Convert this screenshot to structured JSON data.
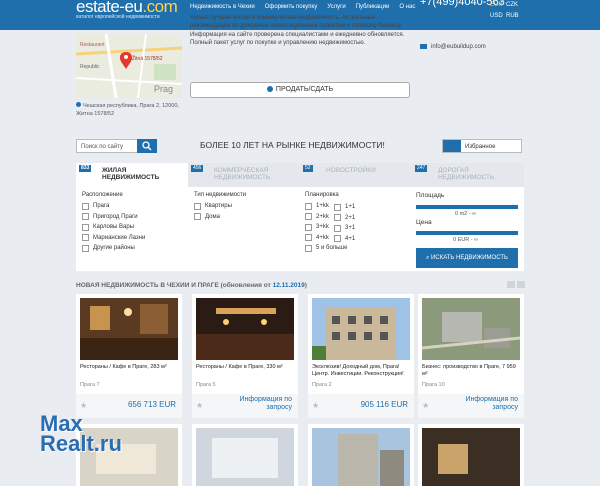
{
  "header": {
    "logo": "estate-eu",
    "logo_domain": ".com",
    "logo_sub": "каталог европейской недвижимости",
    "nav": [
      "Недвижимость в Чехии",
      "Оформить покупку",
      "Услуги",
      "Публикации",
      "О нас"
    ],
    "phone": "+7(499)4040-563",
    "currencies": [
      "EUR",
      "CZK",
      "USD",
      "RUB"
    ]
  },
  "map": {
    "pin_label": "Žitná 1578/52",
    "labels": [
      "Restaurant",
      "Republic",
      "Prag"
    ]
  },
  "address": "Чешская республика, Прага 2, 12000, Житна 1578/52",
  "intro": "только лучшая жилая и коммерческая недвижимость. Актуальные рекомендации по доходным инвестиционным проектам и готовому бизнесу. Информация на сайте проверена специалистами и ежедневно обновляется. Полный пакет услуг по покупке и управлению недвижимостью.",
  "sell_button": "ПРОДАТЬ/СДАТЬ",
  "email": "info@eubuildup.com",
  "search": {
    "placeholder": "Поиск по сайту"
  },
  "headline": "БОЛЕЕ 10 ЛЕТ НА РЫНКЕ НЕДВИЖИМОСТИ!",
  "favorites": "Избранное",
  "tabs": [
    {
      "badge": "833",
      "label": "ЖИЛАЯ НЕДВИЖИМОСТЬ"
    },
    {
      "badge": "456",
      "label": "КОММЕРЧЕСКАЯ НЕДВИЖИМОСТЬ"
    },
    {
      "badge": "52",
      "label": "НОВОСТРОЙКИ"
    },
    {
      "badge": "247",
      "label": "ДОРОГАЯ НЕДВИЖИМОСТЬ"
    }
  ],
  "filters": {
    "location_title": "Расположение",
    "locations": [
      "Прага",
      "Пригород Праги",
      "Карловы Вары",
      "Марианские Лазни",
      "Другие районы"
    ],
    "type_title": "Тип недвижимости",
    "types": [
      "Квартиры",
      "Дома"
    ],
    "layout_title": "Планировка",
    "layouts_a": [
      "1+kk",
      "2+kk",
      "3+kk",
      "4+kk",
      "5 и больше"
    ],
    "layouts_b": [
      "1+1",
      "2+1",
      "3+1",
      "4+1"
    ],
    "area_title": "Площадь",
    "area_value": "0 m2 - ∞",
    "price_title": "Цена",
    "price_value": "0 EUR - ∞",
    "find_button": "ИСКАТЬ НЕДВИЖИМОСТЬ"
  },
  "new_section": {
    "title": "НОВАЯ НЕДВИЖИМОСТЬ В ЧЕХИИ И ПРАГЕ (обновления от ",
    "date": "12.11.2019",
    "close": ")"
  },
  "listings": [
    {
      "title": "Рестораны / Кафе в Праге, 283 м²",
      "location": "Прага 7",
      "price": "656 713 EUR"
    },
    {
      "title": "Рестораны / Кафе в Праге, 330 м²",
      "location": "Прага 5",
      "price": "Информация по запросу"
    },
    {
      "title": "Эксклюзив! Доходный дом, Прага! Центр. Инвестиции. Реконструкция!",
      "location": "Прага 2",
      "price": "905 116 EUR"
    },
    {
      "title": "Бизнес: производство в Праге, 7 959 м²",
      "location": "Прага 10",
      "price": "Информация по запросу"
    }
  ],
  "watermark": {
    "line1": "Max",
    "line2": "Realt.ru"
  },
  "colors": {
    "brand": "#1f6fad",
    "accent": "#ffd34d"
  }
}
